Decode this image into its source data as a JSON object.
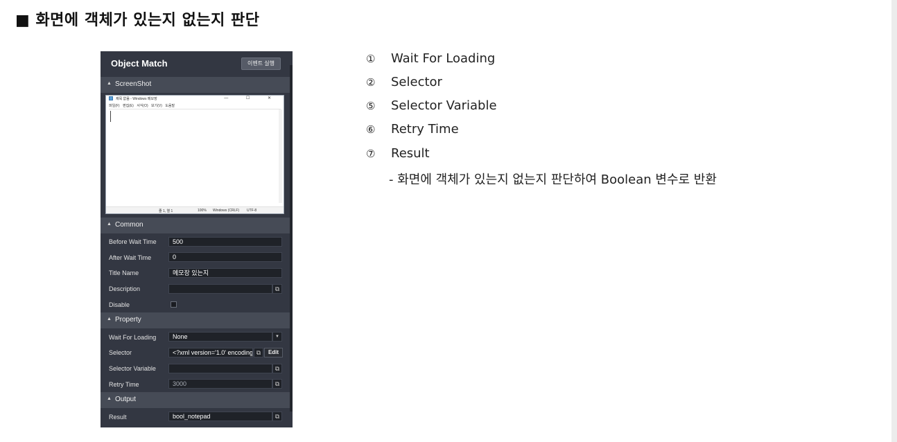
{
  "page": {
    "heading": "■ 화면에 객체가 있는지 없는지 판단"
  },
  "panel": {
    "title": "Object Match",
    "event_button": "이벤트 실행",
    "sections": {
      "screenshot": "ScreenShot",
      "common": "Common",
      "property": "Property",
      "output": "Output"
    },
    "screenshot": {
      "window_title": "제목 없음 - Windows 메모장",
      "window_controls": "— ☐ ✕",
      "menu": "파일(F) 편집(E) 서식(O) 보기(V) 도움말",
      "status_position": "줄 1, 열 1",
      "status_zoom": "100%",
      "status_eol": "Windows (CRLF)",
      "status_encoding": "UTF-8"
    },
    "common": {
      "before_wait_label": "Before Wait Time",
      "before_wait_value": "500",
      "after_wait_label": "After Wait Time",
      "after_wait_value": "0",
      "title_name_label": "Title Name",
      "title_name_value": "메모장 있는지",
      "description_label": "Description",
      "description_value": "",
      "disable_label": "Disable"
    },
    "property": {
      "wait_loading_label": "Wait For Loading",
      "wait_loading_value": "None",
      "selector_label": "Selector",
      "selector_value": "<?xml version='1.0' encoding",
      "selector_edit": "Edit",
      "selector_variable_label": "Selector Variable",
      "selector_variable_value": "",
      "retry_time_label": "Retry Time",
      "retry_time_value": "3000"
    },
    "output": {
      "result_label": "Result",
      "result_value": "bool_notepad"
    },
    "icons": {
      "external": "open-external-icon",
      "dropdown": "chevron-down-icon",
      "collapse": "caret-up-icon"
    }
  },
  "legend": {
    "items": [
      {
        "num": "①",
        "label": "Wait For Loading"
      },
      {
        "num": "②",
        "label": "Selector"
      },
      {
        "num": "⑤",
        "label": "Selector Variable"
      },
      {
        "num": "⑥",
        "label": "Retry Time"
      },
      {
        "num": "⑦",
        "label": "Result"
      }
    ],
    "result_desc": "- 화면에 객체가 있는지 없는지 판단하여 Boolean 변수로 반환"
  }
}
